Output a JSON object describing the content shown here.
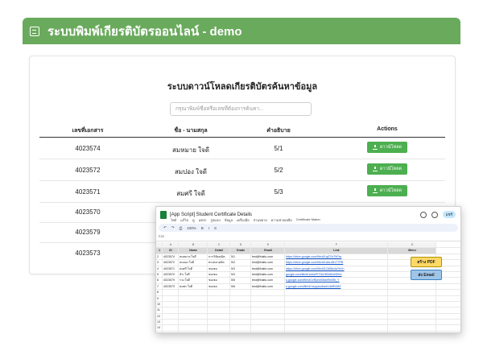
{
  "banner": {
    "title": "ระบบพิมพ์เกียรติบัตรออนไลน์ - demo",
    "color": "#6aaa5d"
  },
  "card": {
    "title": "ระบบดาวน์โหลดเกียรติบัตรค้นหาข้อมูล",
    "search_placeholder": "กรุณาพิมพ์ชื่อหรือเลขที่ต้องการค้นหา...",
    "headers": [
      "เลขที่เอกสาร",
      "ชื่อ - นามสกุล",
      "คำอธิบาย",
      "Actions"
    ],
    "download_label": "ดาวน์โหลด",
    "rows": [
      {
        "doc_no": "4023574",
        "name": "สมหมาย ใจดี",
        "desc": "5/1"
      },
      {
        "doc_no": "4023572",
        "name": "สมปอง ใจดี",
        "desc": "5/2"
      },
      {
        "doc_no": "4023571",
        "name": "สมศรี ใจดี",
        "desc": "5/3"
      },
      {
        "doc_no": "4023570",
        "name": "",
        "desc": ""
      },
      {
        "doc_no": "4023579",
        "name": "",
        "desc": ""
      },
      {
        "doc_no": "4023573",
        "name": "",
        "desc": ""
      }
    ]
  },
  "sheet": {
    "title": "[App Script] Student Certificate Details",
    "menu": [
      "ไฟล์",
      "แก้ไข",
      "ดู",
      "แทรก",
      "รูปแบบ",
      "ข้อมูล",
      "เครื่องมือ",
      "ส่วนขยาย",
      "ความช่วยเหลือ",
      "Certificate Maker"
    ],
    "share_label": "แชร์",
    "zoom": "100%",
    "cell_ref": "F22",
    "col_letters": [
      "A",
      "B",
      "C",
      "D",
      "E",
      "F",
      "G"
    ],
    "col_headers": [
      "ID",
      "Name",
      "Detail",
      "Grade",
      "Email",
      "Link",
      "Menu"
    ],
    "rows": [
      [
        "4023574",
        "สมหมาย ใจดี",
        "การวิจัยคณิต",
        "5/1",
        "test@thaitu.com",
        "https://drive.google.com/file/d/1qiCSxTkPxs"
      ],
      [
        "4023572",
        "สมปอง ใจดี",
        "ทางตลาดบิต",
        "5/2",
        "test@thaitu.com",
        "https://drive.google.com/file/d/1abLdN1T7PB"
      ],
      [
        "4023571",
        "สมศรี ใจดี",
        "ชมเชย",
        "5/3",
        "test@thaitu.com",
        "https://drive.google.com/file/d/1O4BbcfaYbVn"
      ],
      [
        "4023570",
        "สำเ ใจดี",
        "ชมเชย",
        "5/4",
        "test@thaitu.com",
        "google.com/file/d/1mkePIT3tZrfDb8vWDWv"
      ],
      [
        "4023579",
        "รวง ใจดี",
        "ชมเชย",
        "5/5",
        "test@thaitu.com",
        "s.google.com/file/d/1vRpnnB5cbRm0fb_Y"
      ],
      [
        "4023573",
        "สมพร ใจดี",
        "ชมเชย",
        "5/6",
        "test@thaitu.com",
        "e.google.com/file/d/1wppsvdbadVdbR0083"
      ]
    ],
    "btn_pdf": "สร้าง PDF",
    "btn_email": "ส่ง Email",
    "row_numbers": [
      "1",
      "2",
      "3",
      "4",
      "5",
      "6",
      "7",
      "8",
      "9",
      "10",
      "11",
      "12",
      "13",
      "14",
      "15",
      "16",
      "17",
      "18",
      "19"
    ]
  }
}
